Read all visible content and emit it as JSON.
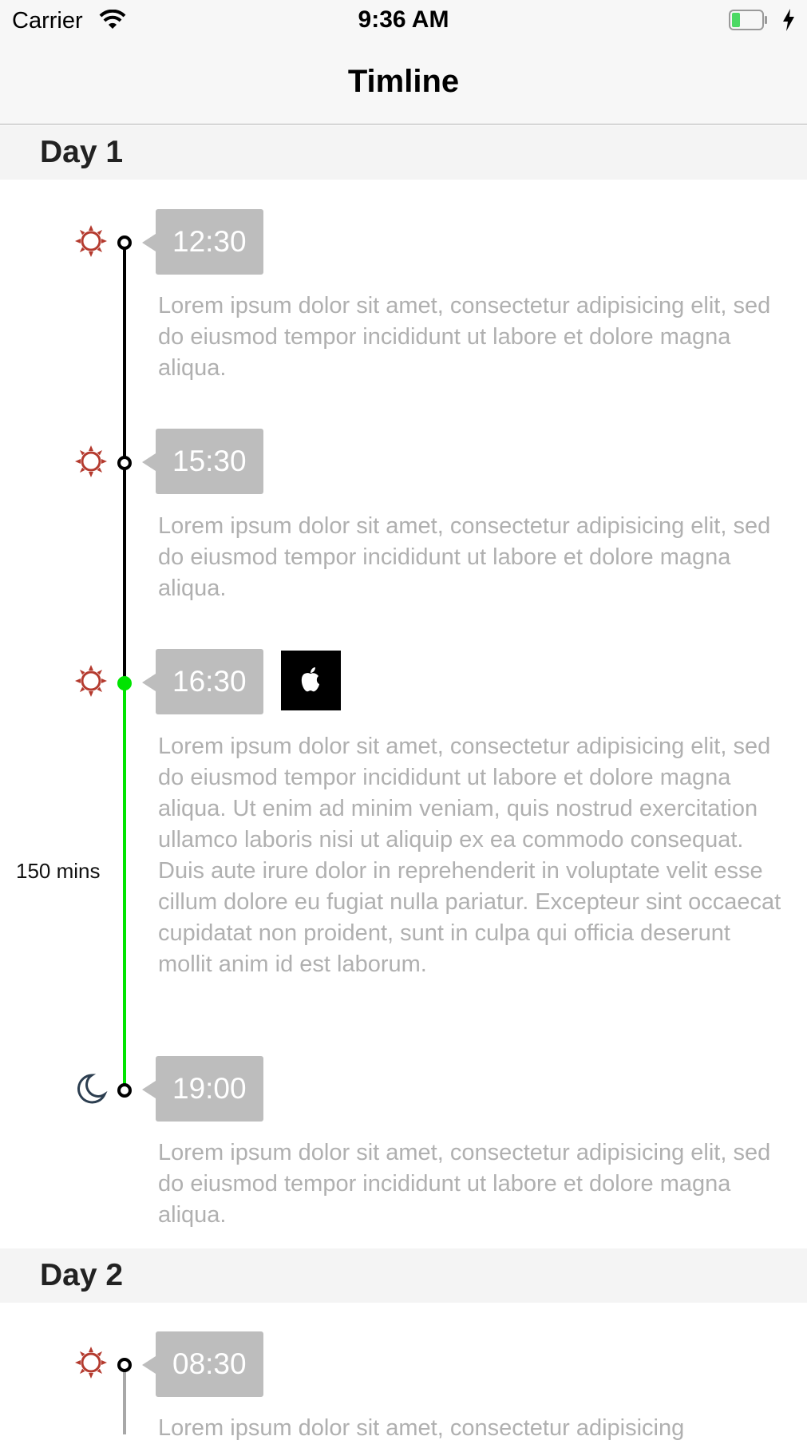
{
  "status_bar": {
    "carrier": "Carrier",
    "time": "9:36 AM",
    "icons": [
      "wifi-icon",
      "battery-icon",
      "charging-bolt-icon"
    ],
    "battery_color": "#4cd964"
  },
  "nav": {
    "title": "Timline"
  },
  "colors": {
    "line": "#000000",
    "active_line": "#00e400",
    "sun": "#b43a2e",
    "moon": "#2c3e50",
    "badge": "#bdbdbd",
    "description": "#b0b0b0"
  },
  "sections": [
    {
      "title": "Day 1",
      "events": [
        {
          "time": "12:30",
          "icon": "sun-icon",
          "description": "Lorem ipsum dolor sit amet, consectetur adipisicing elit, sed do eiusmod tempor incididunt ut labore et dolore magna aliqua."
        },
        {
          "time": "15:30",
          "icon": "sun-icon",
          "description": "Lorem ipsum dolor sit amet, consectetur adipisicing elit, sed do eiusmod tempor incididunt ut labore et dolore magna aliqua."
        },
        {
          "time": "16:30",
          "icon": "sun-icon",
          "thumbnail": "apple-icon",
          "duration": "150 mins",
          "description": "Lorem ipsum dolor sit amet, consectetur adipisicing elit, sed do eiusmod tempor incididunt ut labore et dolore magna aliqua. Ut enim ad minim veniam, quis nostrud exercitation ullamco laboris nisi ut aliquip ex ea commodo consequat. Duis aute irure dolor in reprehenderit in voluptate velit esse cillum dolore eu fugiat nulla pariatur. Excepteur sint occaecat cupidatat non proident, sunt in culpa qui officia deserunt mollit anim id est laborum."
        },
        {
          "time": "19:00",
          "icon": "moon-icon",
          "description": "Lorem ipsum dolor sit amet, consectetur adipisicing elit, sed do eiusmod tempor incididunt ut labore et dolore magna aliqua."
        }
      ]
    },
    {
      "title": "Day 2",
      "events": [
        {
          "time": "08:30",
          "icon": "sun-icon",
          "description": "Lorem ipsum dolor sit amet, consectetur adipisicing"
        }
      ]
    }
  ]
}
